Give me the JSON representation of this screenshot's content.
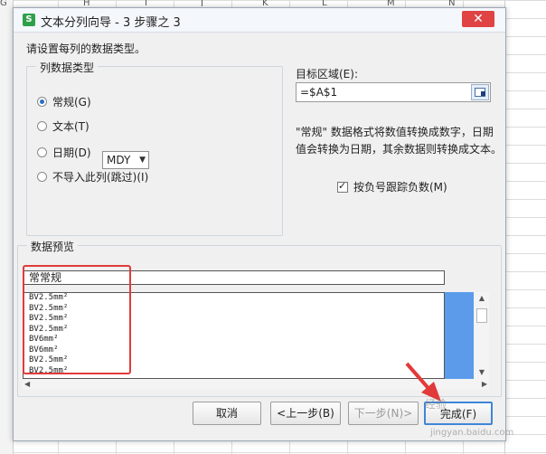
{
  "sheet": {
    "column_headers": [
      "G",
      "H",
      "I",
      "J",
      "K",
      "L",
      "M",
      "N"
    ]
  },
  "dialog": {
    "title": "文本分列向导 - 3 步骤之 3",
    "close_icon": "close-icon",
    "app_icon_letter": "S",
    "instruction": "请设置每列的数据类型。",
    "column_type_group": {
      "legend": "列数据类型",
      "options": [
        {
          "label": "常规(G)",
          "checked": true
        },
        {
          "label": "文本(T)",
          "checked": false
        },
        {
          "label": "日期(D)",
          "checked": false
        },
        {
          "label": "不导入此列(跳过)(I)",
          "checked": false
        }
      ],
      "date_format_selected": "MDY"
    },
    "target": {
      "label": "目标区域(E):",
      "value": "=$A$1",
      "picker_icon": "range-picker-icon"
    },
    "description": "\"常规\" 数据格式将数值转换成数字，日期值会转换为日期，其余数据则转换成文本。",
    "negative_checkbox": {
      "label": "按负号跟踪负数(M)",
      "checked": true
    },
    "preview": {
      "legend": "数据预览",
      "header": "常常规",
      "rows": [
        "BV2.5mm²",
        "BV2.5mm²",
        "BV2.5mm²",
        "BV2.5mm²",
        "BV6mm²",
        "BV6mm²",
        "BV2.5mm²",
        "BV2.5mm²"
      ]
    },
    "buttons": {
      "cancel": "取消",
      "back": "<上一步(B)",
      "next": "下一步(N)>",
      "finish": "完成(F)"
    },
    "watermark": "经验",
    "watermark_url": "jingyan.baidu.com"
  },
  "colors": {
    "selected_column": "#5b9bea",
    "annotation": "#e23a3a",
    "radio_selected": "#2b6fc3"
  }
}
